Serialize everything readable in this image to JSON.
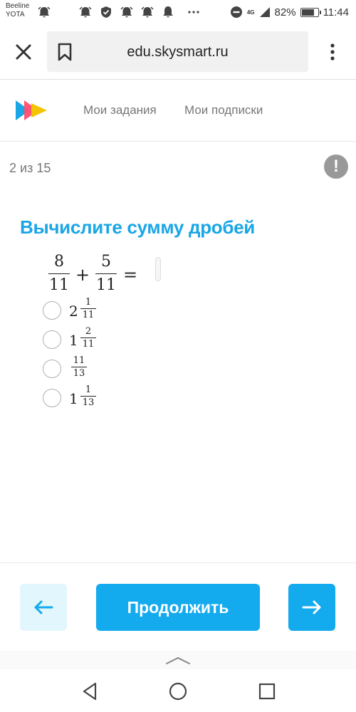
{
  "status_bar": {
    "carrier_line1": "Beeline",
    "carrier_line2": "YOTA",
    "network": "4G",
    "battery": "82%",
    "battery_level": 0.82,
    "time": "11:44"
  },
  "browser": {
    "url": "edu.skysmart.ru"
  },
  "site_header": {
    "nav": [
      "Мои задания",
      "Мои подписки"
    ],
    "logo_colors": [
      "#1aa6e6",
      "#f5c400",
      "#ff4d6d"
    ]
  },
  "progress": {
    "text": "2 из 15",
    "report_icon": "!"
  },
  "task": {
    "title": "Вычислите сумму дробей",
    "equation": {
      "left": {
        "num": "8",
        "den": "11"
      },
      "op": "+",
      "right": {
        "num": "5",
        "den": "11"
      },
      "equals": "="
    },
    "options": [
      {
        "whole": "2",
        "num": "1",
        "den": "11"
      },
      {
        "whole": "1",
        "num": "2",
        "den": "11"
      },
      {
        "whole": "",
        "num": "11",
        "den": "13"
      },
      {
        "whole": "1",
        "num": "1",
        "den": "13"
      }
    ]
  },
  "actions": {
    "continue_label": "Продолжить",
    "accent_color": "#13aaee"
  }
}
